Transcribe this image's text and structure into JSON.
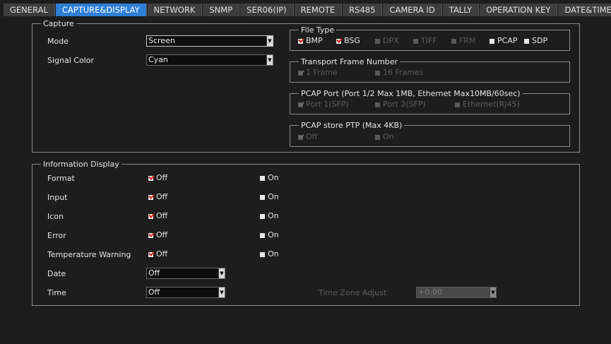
{
  "tabs": [
    "GENERAL",
    "CAPTURE&DISPLAY",
    "NETWORK",
    "SNMP",
    "SER06(IP)",
    "REMOTE",
    "RS485",
    "CAMERA ID",
    "TALLY",
    "OPERATION KEY",
    "DATE&TIME"
  ],
  "active_tab": 1,
  "capture": {
    "legend": "Capture",
    "mode_label": "Mode",
    "mode_value": "Screen",
    "signal_color_label": "Signal Color",
    "signal_color_value": "Cyan",
    "file_type": {
      "legend": "File Type",
      "items": [
        {
          "label": "BMP",
          "checked": true,
          "enabled": true
        },
        {
          "label": "BSG",
          "checked": true,
          "enabled": true
        },
        {
          "label": "DPX",
          "checked": false,
          "enabled": false
        },
        {
          "label": "TIFF",
          "checked": false,
          "enabled": false
        },
        {
          "label": "FRM",
          "checked": false,
          "enabled": false
        },
        {
          "label": "PCAP",
          "checked": false,
          "enabled": true
        },
        {
          "label": "SDP",
          "checked": false,
          "enabled": true
        }
      ]
    },
    "transport_frame": {
      "legend": "Transport Frame Number",
      "items": [
        {
          "label": "1 Frame",
          "checked": true,
          "enabled": false
        },
        {
          "label": "16 Frames",
          "checked": false,
          "enabled": false
        }
      ]
    },
    "pcap_port": {
      "legend": "PCAP Port (Port 1/2 Max 1MB, Ethernet Max10MB/60sec)",
      "items": [
        {
          "label": "Port 1(SFP)",
          "checked": true,
          "enabled": false
        },
        {
          "label": "Port 2(SFP)",
          "checked": false,
          "enabled": false
        },
        {
          "label": "Ethernet(RJ45)",
          "checked": false,
          "enabled": false
        }
      ]
    },
    "pcap_ptp": {
      "legend": "PCAP store PTP (Max 4KB)",
      "items": [
        {
          "label": "Off",
          "checked": true,
          "enabled": false
        },
        {
          "label": "On",
          "checked": false,
          "enabled": false
        }
      ]
    }
  },
  "info_display": {
    "legend": "Information Display",
    "rows": [
      {
        "label": "Format",
        "off": "Off",
        "on": "On"
      },
      {
        "label": "Input",
        "off": "Off",
        "on": "On"
      },
      {
        "label": "Icon",
        "off": "Off",
        "on": "On"
      },
      {
        "label": "Error",
        "off": "Off",
        "on": "On"
      },
      {
        "label": "Temperature Warning",
        "off": "Off",
        "on": "On"
      }
    ],
    "date_label": "Date",
    "date_value": "Off",
    "time_label": "Time",
    "time_value": "Off",
    "tz_label": "Time Zone Adjust",
    "tz_value": "+0:00"
  },
  "colors": {
    "active_tab": "#2f7fd6",
    "check": "#d42020",
    "background": "#1d1d1d"
  }
}
